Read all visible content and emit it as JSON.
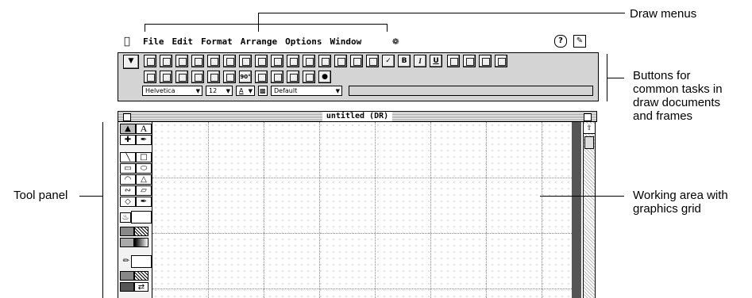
{
  "callouts": {
    "draw_menus": "Draw menus",
    "buttons_line1": "Buttons for",
    "buttons_line2": "common tasks in",
    "buttons_line3": "draw documents",
    "buttons_line4": "and frames",
    "tool_panel": "Tool panel",
    "working_line1": "Working area with",
    "working_line2": "graphics grid"
  },
  "menubar": {
    "apple": "",
    "items": [
      "File",
      "Edit",
      "Format",
      "Arrange",
      "Options",
      "Window"
    ],
    "help_label": "?",
    "script_icon": "script-icon",
    "help_icon": "help-icon",
    "app_icon": "application-icon"
  },
  "toolbar": {
    "bold_label": "B",
    "italic_label": "I",
    "underline_label": "U",
    "font_value": "Helvetica",
    "size_value": "12",
    "color_value": "A",
    "style_value": "Default"
  },
  "window": {
    "title": "untitled (DR)"
  },
  "tools": {
    "text_tool": "A"
  }
}
